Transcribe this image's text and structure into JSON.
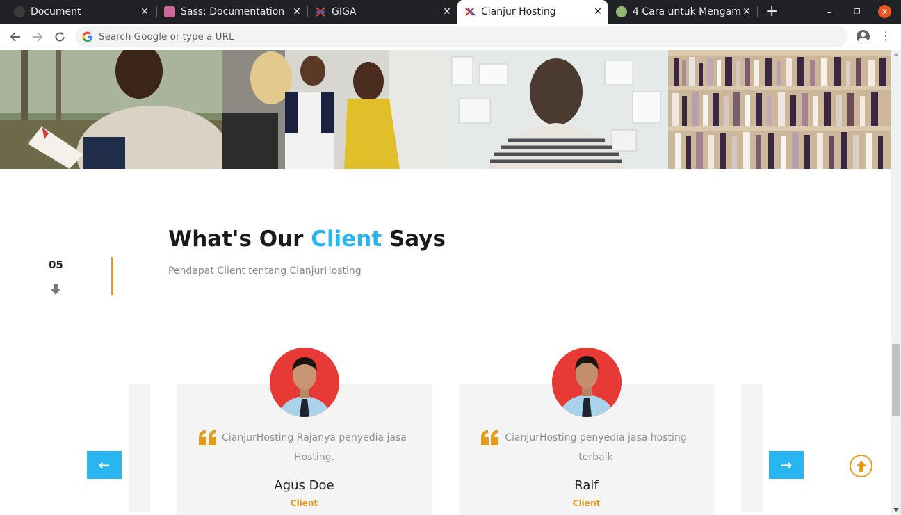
{
  "browser": {
    "tabs": [
      {
        "title": "Document",
        "active": false
      },
      {
        "title": "Sass: Documentation",
        "active": false
      },
      {
        "title": "GIGA",
        "active": false
      },
      {
        "title": "Cianjur Hosting",
        "active": true
      },
      {
        "title": "4 Cara untuk Mengamb",
        "active": false
      }
    ],
    "new_tab_label": "+",
    "omnibox_placeholder": "Search Google or type a URL"
  },
  "page": {
    "section_number": "05",
    "heading_before": "What's Our ",
    "heading_accent": "Client",
    "heading_after": " Says",
    "subheading": "Pendapat Client tentang CianjurHosting",
    "testimonials": [
      {
        "quote": "CianjurHosting Rajanya penyedia jasa Hosting.",
        "name": "Agus Doe",
        "role": "Client"
      },
      {
        "quote": "CianjurHosting penyedia jasa hosting terbaik",
        "name": "Raif",
        "role": "Client"
      }
    ],
    "prev_arrow": "←",
    "next_arrow": "→"
  },
  "colors": {
    "accent_blue": "#29b6f0",
    "accent_orange": "#e29b1f",
    "avatar_bg": "#e83a34",
    "card_bg": "#f4f4f4"
  },
  "icons": [
    "back-icon",
    "forward-icon",
    "reload-icon",
    "google-icon",
    "account-icon",
    "menu-icon",
    "arrow-down-icon",
    "quote-icon",
    "arrow-left-icon",
    "arrow-right-icon",
    "scroll-to-top-icon"
  ]
}
